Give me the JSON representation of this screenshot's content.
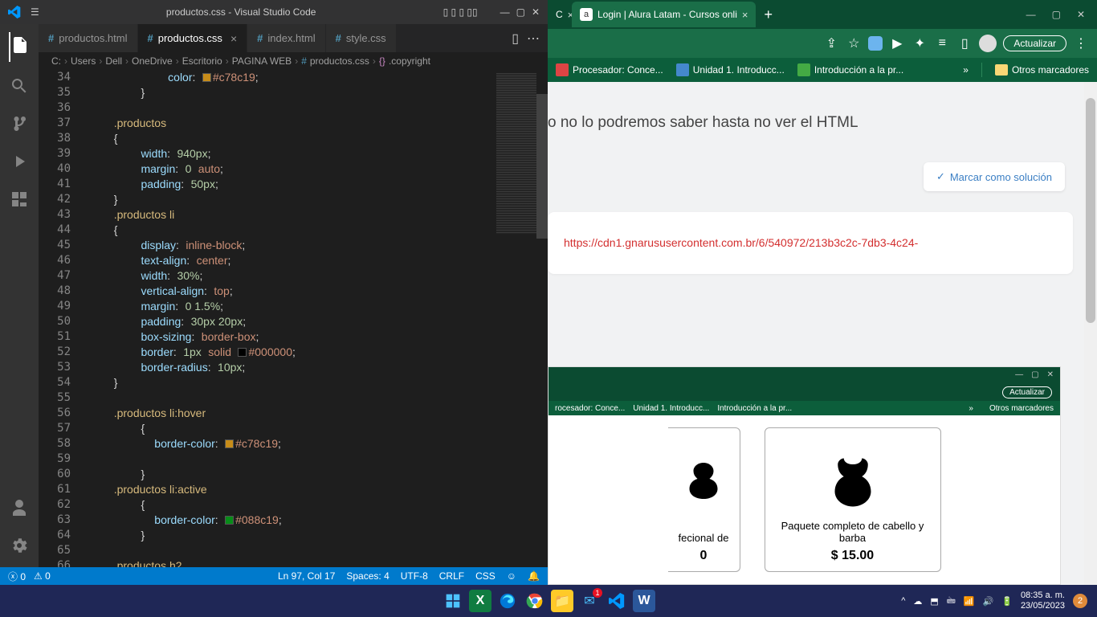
{
  "vscode": {
    "title": "productos.css - Visual Studio Code",
    "tabs": [
      {
        "icon": "#",
        "name": "productos.html"
      },
      {
        "icon": "#",
        "name": "productos.css",
        "active": true
      },
      {
        "icon": "#",
        "name": "index.html"
      },
      {
        "icon": "#",
        "name": "style.css"
      }
    ],
    "breadcrumbs": [
      "C:",
      "Users",
      "Dell",
      "OneDrive",
      "Escritorio",
      "PAGINA WEB",
      "productos.css",
      ".copyright"
    ],
    "lines_start": 34,
    "statusbar": {
      "errors": "0",
      "warnings": "0",
      "cursor": "Ln 97, Col 17",
      "spaces": "Spaces: 4",
      "encoding": "UTF-8",
      "eol": "CRLF",
      "lang": "CSS"
    }
  },
  "edge": {
    "tab_active": "Login | Alura Latam - Cursos onli",
    "bookmarks": [
      "Procesador: Conce...",
      "Unidad 1. Introducc...",
      "Introducción a la pr..."
    ],
    "bookmarks_more": "»",
    "bookmarks_folder": "Otros marcadores",
    "page_text": "o no lo podremos saber hasta no ver el HTML",
    "solution_btn": "Marcar como solución",
    "code_url": "https://cdn1.gnarususercontent.com.br/6/540972/213b3c2c-7db3-4c24-",
    "actualizar": "Actualizar",
    "mini": {
      "bookmarks": [
        "rocesador: Conce...",
        "Unidad 1. Introducc...",
        "Introducción a la pr...",
        "»",
        "Otros marcadores"
      ],
      "product1_name": "fecional de",
      "product2_name": "Paquete completo de cabello y barba",
      "product2_price": "$ 15.00"
    }
  },
  "taskbar": {
    "time": "08:35 a. m.",
    "date": "23/05/2023",
    "notif": "2"
  }
}
